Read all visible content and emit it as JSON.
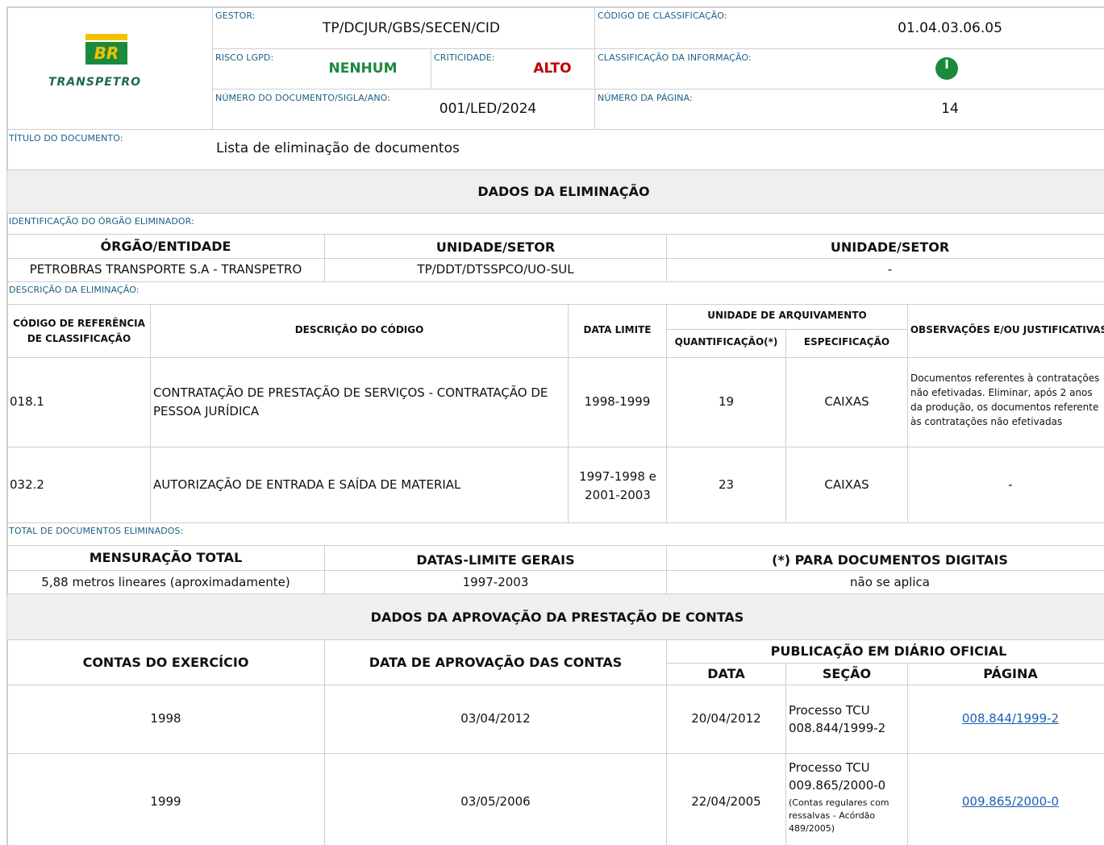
{
  "header": {
    "logo_top": "BR",
    "logo_bottom": "TRANSPETRO",
    "gestor_label": "GESTOR:",
    "gestor": "TP/DCJUR/GBS/SECEN/CID",
    "codigo_label": "CÓDIGO DE CLASSIFICAÇÃO:",
    "codigo": "01.04.03.06.05",
    "risco_label": "RISCO LGPD:",
    "risco": "NENHUM",
    "criticidade_label": "CRITICIDADE:",
    "criticidade": "ALTO",
    "classificacao_label": "CLASSIFICAÇÃO DA INFORMAÇÃO:",
    "classificacao_badge": "I",
    "numero_label": "NÚMERO DO DOCUMENTO/SIGLA/ANO:",
    "numero": "001/LED/2024",
    "pagina_label": "NÚMERO DA PÁGINA:",
    "pagina": "14",
    "titulo_label": "TÍTULO DO DOCUMENTO:",
    "titulo": "Lista de eliminação de documentos",
    "colors": {
      "green": "#1b8a3d",
      "red": "#c00000",
      "caption": "#1c5e86",
      "badge": "#1b8a3d"
    }
  },
  "eliminacao": {
    "band_title": "DADOS DA ELIMINAÇÃO",
    "orgao_caption": "IDENTIFICAÇÃO DO ÓRGÃO ELIMINADOR:",
    "orgao_headers": [
      "ÓRGÃO/ENTIDADE",
      "UNIDADE/SETOR",
      "UNIDADE/SETOR"
    ],
    "orgao_values": [
      "PETROBRAS TRANSPORTE S.A - TRANSPETRO",
      "TP/DDT/DTSSPCO/UO-SUL",
      "-"
    ],
    "descricao_caption": "DESCRIÇÃO DA ELIMINAÇÃO:",
    "table_headers": {
      "codigo": "CÓDIGO DE REFERÊNCIA DE CLASSIFICAÇÃO",
      "descricao": "DESCRIÇÃO DO CÓDIGO",
      "data": "DATA LIMITE",
      "unidade": "UNIDADE DE ARQUIVAMENTO",
      "quant": "QUANTIFICAÇÃO(*)",
      "espec": "ESPECIFICAÇÃO",
      "obs": "OBSERVAÇÕES E/OU JUSTIFICATIVAS"
    },
    "rows": [
      {
        "codigo": "018.1",
        "descricao": "CONTRATAÇÃO DE PRESTAÇÃO DE SERVIÇOS - CONTRATAÇÃO DE PESSOA JURÍDICA",
        "data": "1998-1999",
        "quant": "19",
        "espec": "CAIXAS",
        "obs": "Documentos referentes à contratações não efetivadas.  Eliminar, após 2 anos da produção, os documentos referente às contratações não efetivadas"
      },
      {
        "codigo": "032.2",
        "descricao": "AUTORIZAÇÃO DE ENTRADA E SAÍDA DE MATERIAL",
        "data": "1997-1998 e 2001-2003",
        "quant": "23",
        "espec": "CAIXAS",
        "obs": "-"
      }
    ],
    "total_caption": "TOTAL DE DOCUMENTOS ELIMINADOS:",
    "total_headers": [
      "MENSURAÇÃO TOTAL",
      "DATAS-LIMITE GERAIS",
      "(*) PARA DOCUMENTOS DIGITAIS"
    ],
    "total_values": [
      "5,88 metros lineares (aproximadamente)",
      "1997-2003",
      "não se aplica"
    ]
  },
  "contas": {
    "band_title": "DADOS DA APROVAÇÃO DA PRESTAÇÃO DE CONTAS",
    "headers": {
      "exercicio": "CONTAS DO EXERCÍCIO",
      "aprovacao": "DATA DE APROVAÇÃO DAS CONTAS",
      "publicacao": "PUBLICAÇÃO EM DIÁRIO OFICIAL",
      "data": "DATA",
      "secao": "SEÇÃO",
      "pagina": "PÁGINA"
    },
    "rows": [
      {
        "exercicio": "1998",
        "aprovacao": "03/04/2012",
        "data": "20/04/2012",
        "secao_main": "Processo TCU 008.844/1999-2",
        "secao_note": "",
        "pagina": "008.844/1999-2"
      },
      {
        "exercicio": "1999",
        "aprovacao": "03/05/2006",
        "data": "22/04/2005",
        "secao_main": "Processo TCU 009.865/2000-0",
        "secao_note": "(Contas regulares com ressalvas - Acórdão 489/2005)",
        "pagina": "009.865/2000-0"
      }
    ]
  }
}
